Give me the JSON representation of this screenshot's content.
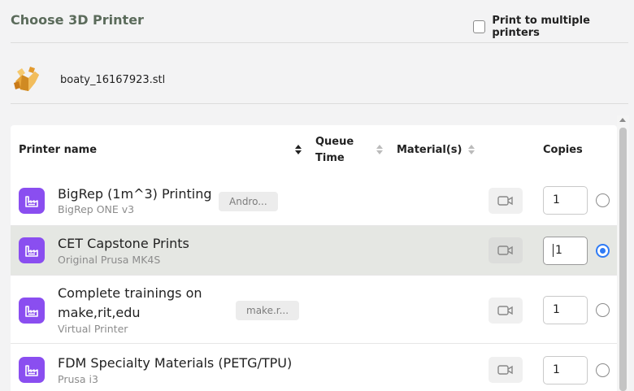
{
  "header": {
    "title": "Choose 3D Printer",
    "multi_print_label": "Print to multiple printers",
    "multi_print_checked": false
  },
  "file": {
    "name": "boaty_16167923.stl",
    "thumbnail_icon": "boat-model-thumbnail"
  },
  "table": {
    "columns": {
      "printer_name": "Printer name",
      "queue_time_line1": "Queue",
      "queue_time_line2": "Time",
      "materials": "Material(s)",
      "copies": "Copies"
    },
    "sort": {
      "column": "printer_name",
      "direction": "ascending"
    },
    "rows": [
      {
        "name": "BigRep (1m^3) Printing",
        "model": "BigRep ONE v3",
        "tag": "Andro...",
        "copies": "1",
        "selected": false,
        "icon": "printer-factory-icon",
        "camera_icon": "video-camera-icon"
      },
      {
        "name": "CET Capstone Prints",
        "model": "Original Prusa MK4S",
        "tag": "",
        "copies": "1",
        "selected": true,
        "icon": "printer-factory-icon",
        "camera_icon": "video-camera-icon"
      },
      {
        "name_line1": "Complete trainings on",
        "name_line2": "make,rit,edu",
        "model": "Virtual Printer",
        "tag": "make.r...",
        "copies": "1",
        "selected": false,
        "icon": "printer-factory-icon",
        "camera_icon": "video-camera-icon"
      },
      {
        "name": "FDM Specialty Materials (PETG/TPU)",
        "model": "Prusa i3",
        "tag": "",
        "copies": "1",
        "selected": false,
        "icon": "printer-factory-icon",
        "camera_icon": "video-camera-icon"
      }
    ]
  },
  "colors": {
    "accent_purple": "#8a4ef0",
    "radio_blue": "#2f7bf5",
    "title_green_gray": "#5b6b5b",
    "selected_row": "#e5e7e3"
  }
}
